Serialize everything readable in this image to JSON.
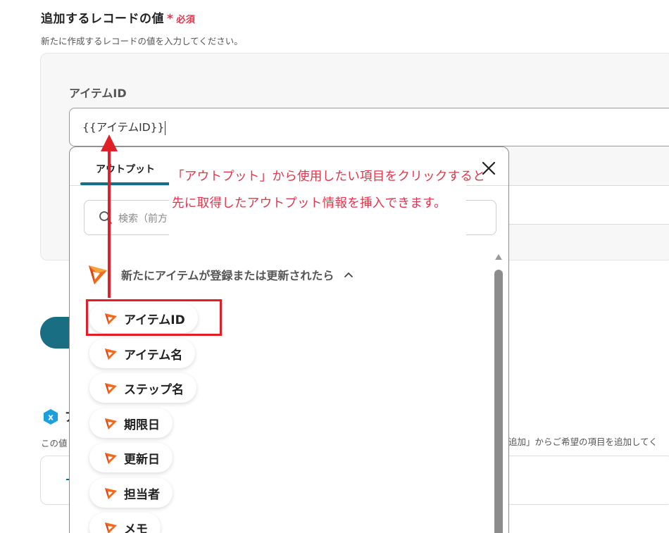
{
  "section": {
    "title": "追加するレコードの値",
    "required_star": "*",
    "required_label": "必須",
    "description": "新たに作成するレコードの値を入力してください。"
  },
  "field": {
    "label": "アイテムID",
    "value": "{{アイテムID}}"
  },
  "popup": {
    "tab_label": "アウトプット",
    "search_placeholder": "検索（前方",
    "group_label": "新たにアイテムが登録または更新されたら",
    "items": [
      {
        "label": "アイテムID"
      },
      {
        "label": "アイテム名"
      },
      {
        "label": "ステップ名"
      },
      {
        "label": "期限日"
      },
      {
        "label": "更新日"
      },
      {
        "label": "担当者"
      },
      {
        "label": "メモ"
      }
    ]
  },
  "annotation": {
    "line1": "「アウトプット」から使用したい項目をクリックすると",
    "line2": "先に取得したアウトプット情報を挿入できます。"
  },
  "section2": {
    "title_fragment": "ア",
    "desc_left": "この値",
    "desc_right": "追加」からご希望の項目を追加してく"
  },
  "colors": {
    "accent": "#1a6e84",
    "required": "#e0364b",
    "highlight": "#e01f26",
    "annotation_text": "#e0364b",
    "app_icon_orange": "#f26b1d"
  }
}
